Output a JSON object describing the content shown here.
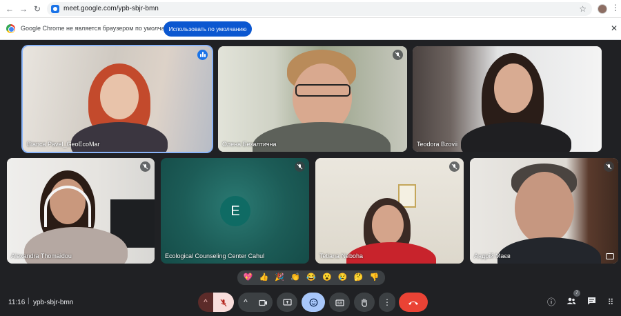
{
  "browser": {
    "back_label": "←",
    "forward_label": "→",
    "reload_label": "↻",
    "url": "meet.google.com/ypb-sbjr-bmn",
    "star_label": "☆",
    "menu_label": "⋮"
  },
  "info_bar": {
    "message": "Google Chrome не является браузером по умолчанию.",
    "button_label": "Использовать по умолчанию",
    "close_label": "✕"
  },
  "participants": [
    {
      "name": "Bianca Pavel_GeoEcoMar",
      "speaking": true
    },
    {
      "name": "Олена Безалтична",
      "muted": true
    },
    {
      "name": "Teodora Bzovii"
    },
    {
      "name": "Alexandra Thomaidou",
      "muted": true
    },
    {
      "name": "Ecological Counseling Center Cahul",
      "avatar_letter": "E",
      "muted": true
    },
    {
      "name": "Tetiana Neboha",
      "muted": true
    },
    {
      "name": "Андрій Маєв",
      "muted": true
    }
  ],
  "reactions": [
    "💖",
    "👍",
    "🎉",
    "👏",
    "😂",
    "😮",
    "😢",
    "🤔",
    "👎"
  ],
  "meeting": {
    "time": "11:16",
    "separator": "|",
    "code": "ypb-sbjr-bmn",
    "participants_count": "7"
  },
  "controls": {
    "chevron_up": "^",
    "more_label": "⋮",
    "info_icon": "ⓘ",
    "grid_icon": "⠿"
  },
  "colors": {
    "background": "#202124",
    "accent_blue": "#1a73e8",
    "end_call": "#ea4335",
    "avatar_teal": "#0f6b64"
  }
}
